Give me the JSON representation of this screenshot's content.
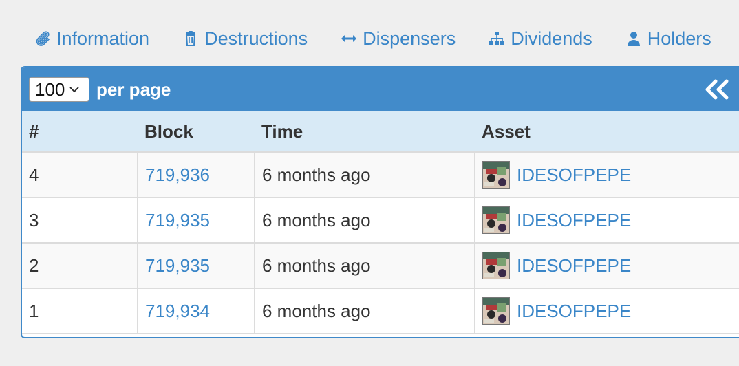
{
  "tabs": [
    {
      "label": "Information",
      "icon": "paperclip-icon"
    },
    {
      "label": "Destructions",
      "icon": "trash-icon"
    },
    {
      "label": "Dispensers",
      "icon": "arrows-horizontal-icon"
    },
    {
      "label": "Dividends",
      "icon": "sitemap-icon"
    },
    {
      "label": "Holders",
      "icon": "user-icon"
    }
  ],
  "table_header": {
    "page_size": "100",
    "per_page_label": "per page"
  },
  "columns": [
    "#",
    "Block",
    "Time",
    "Asset"
  ],
  "rows": [
    {
      "num": "4",
      "block": "719,936",
      "time": "6 months ago",
      "asset": "IDESOFPEPE"
    },
    {
      "num": "3",
      "block": "719,935",
      "time": "6 months ago",
      "asset": "IDESOFPEPE"
    },
    {
      "num": "2",
      "block": "719,935",
      "time": "6 months ago",
      "asset": "IDESOFPEPE"
    },
    {
      "num": "1",
      "block": "719,934",
      "time": "6 months ago",
      "asset": "IDESOFPEPE"
    }
  ],
  "colors": {
    "accent": "#428bca",
    "link": "#3a86c8",
    "header_bg": "#d8eaf6"
  }
}
